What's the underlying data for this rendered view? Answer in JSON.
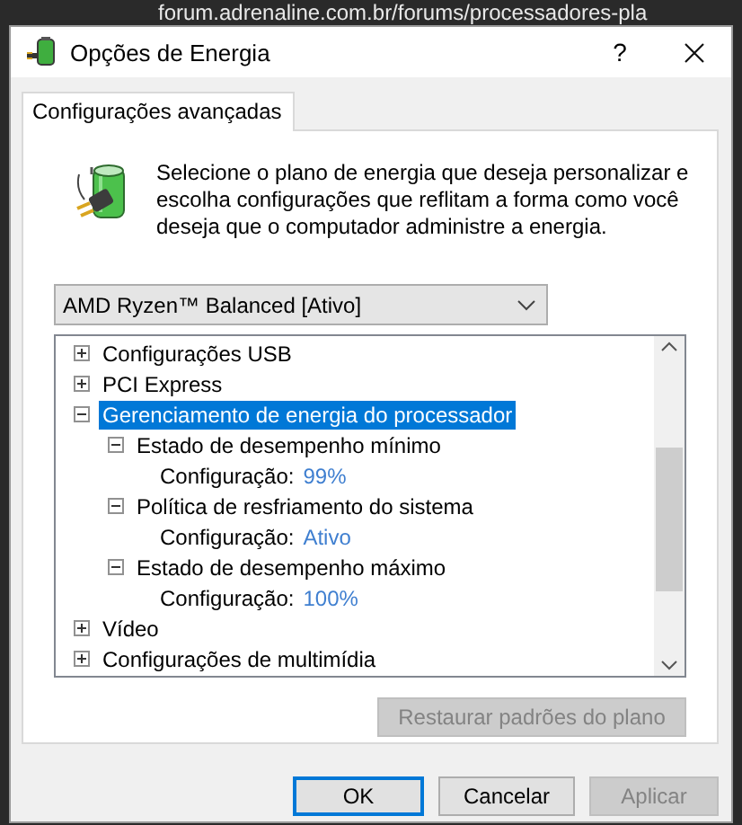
{
  "background": {
    "address": "forum.adrenaline.com.br/forums/processadores-pla"
  },
  "window": {
    "title": "Opções de Energia",
    "help": "?"
  },
  "tabs": [
    {
      "label": "Configurações avançadas",
      "selected": true
    }
  ],
  "description": "Selecione o plano de energia que deseja personalizar e escolha configurações que reflitam a forma como você deseja que o computador administre a energia.",
  "plan_dropdown": {
    "value": "AMD Ryzen™ Balanced [Ativo]"
  },
  "tree": [
    {
      "kind": "group",
      "label": "Configurações USB",
      "expanded": false,
      "selected": false
    },
    {
      "kind": "group",
      "label": "PCI Express",
      "expanded": false,
      "selected": false
    },
    {
      "kind": "group",
      "label": "Gerenciamento de energia do processador",
      "expanded": true,
      "selected": true,
      "children": [
        {
          "kind": "group",
          "label": "Estado de desempenho mínimo",
          "expanded": true,
          "selected": false,
          "children": [
            {
              "kind": "setting",
              "label": "Configuração:",
              "value": "99%"
            }
          ]
        },
        {
          "kind": "group",
          "label": "Política de resfriamento do sistema",
          "expanded": true,
          "selected": false,
          "children": [
            {
              "kind": "setting",
              "label": "Configuração:",
              "value": "Ativo"
            }
          ]
        },
        {
          "kind": "group",
          "label": "Estado de desempenho máximo",
          "expanded": true,
          "selected": false,
          "children": [
            {
              "kind": "setting",
              "label": "Configuração:",
              "value": "100%"
            }
          ]
        }
      ]
    },
    {
      "kind": "group",
      "label": "Vídeo",
      "expanded": false,
      "selected": false
    },
    {
      "kind": "group",
      "label": "Configurações de multimídia",
      "expanded": false,
      "selected": false
    }
  ],
  "restore_button": {
    "label": "Restaurar padrões do plano",
    "disabled": true
  },
  "buttons": [
    {
      "label": "OK",
      "default": true,
      "disabled": false
    },
    {
      "label": "Cancelar",
      "default": false,
      "disabled": false
    },
    {
      "label": "Aplicar",
      "default": false,
      "disabled": true
    }
  ]
}
